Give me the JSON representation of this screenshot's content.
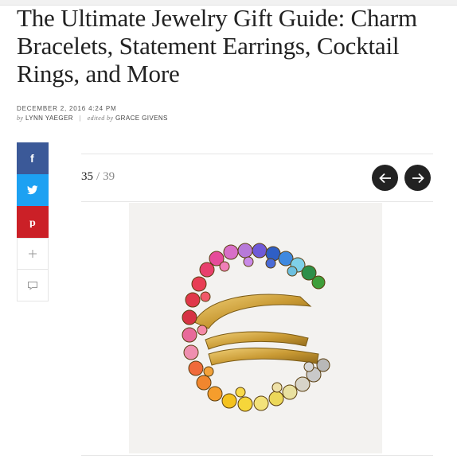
{
  "article": {
    "headline": "The Ultimate Jewelry Gift Guide: Charm Bracelets, Statement Earrings, Cocktail Rings, and More",
    "date": "DECEMBER 2, 2016 4:24 PM",
    "byline_prefix": "by",
    "author": "LYNN YAEGER",
    "editor_prefix": "edited by",
    "editor": "GRACE GIVENS"
  },
  "share": [
    {
      "network": "facebook",
      "icon": "facebook-icon",
      "color": "#3b5998"
    },
    {
      "network": "twitter",
      "icon": "twitter-icon",
      "color": "#1da1f2"
    },
    {
      "network": "pinterest",
      "icon": "pinterest-icon",
      "color": "#cb2027"
    },
    {
      "network": "more",
      "icon": "plus-icon"
    },
    {
      "network": "comment",
      "icon": "comment-icon"
    }
  ],
  "slideshow": {
    "current": "35",
    "separator": "/",
    "total": "39",
    "prev_icon": "arrow-left-icon",
    "next_icon": "arrow-right-icon",
    "image_subject": "rainbow gemstone cocktail ring"
  }
}
